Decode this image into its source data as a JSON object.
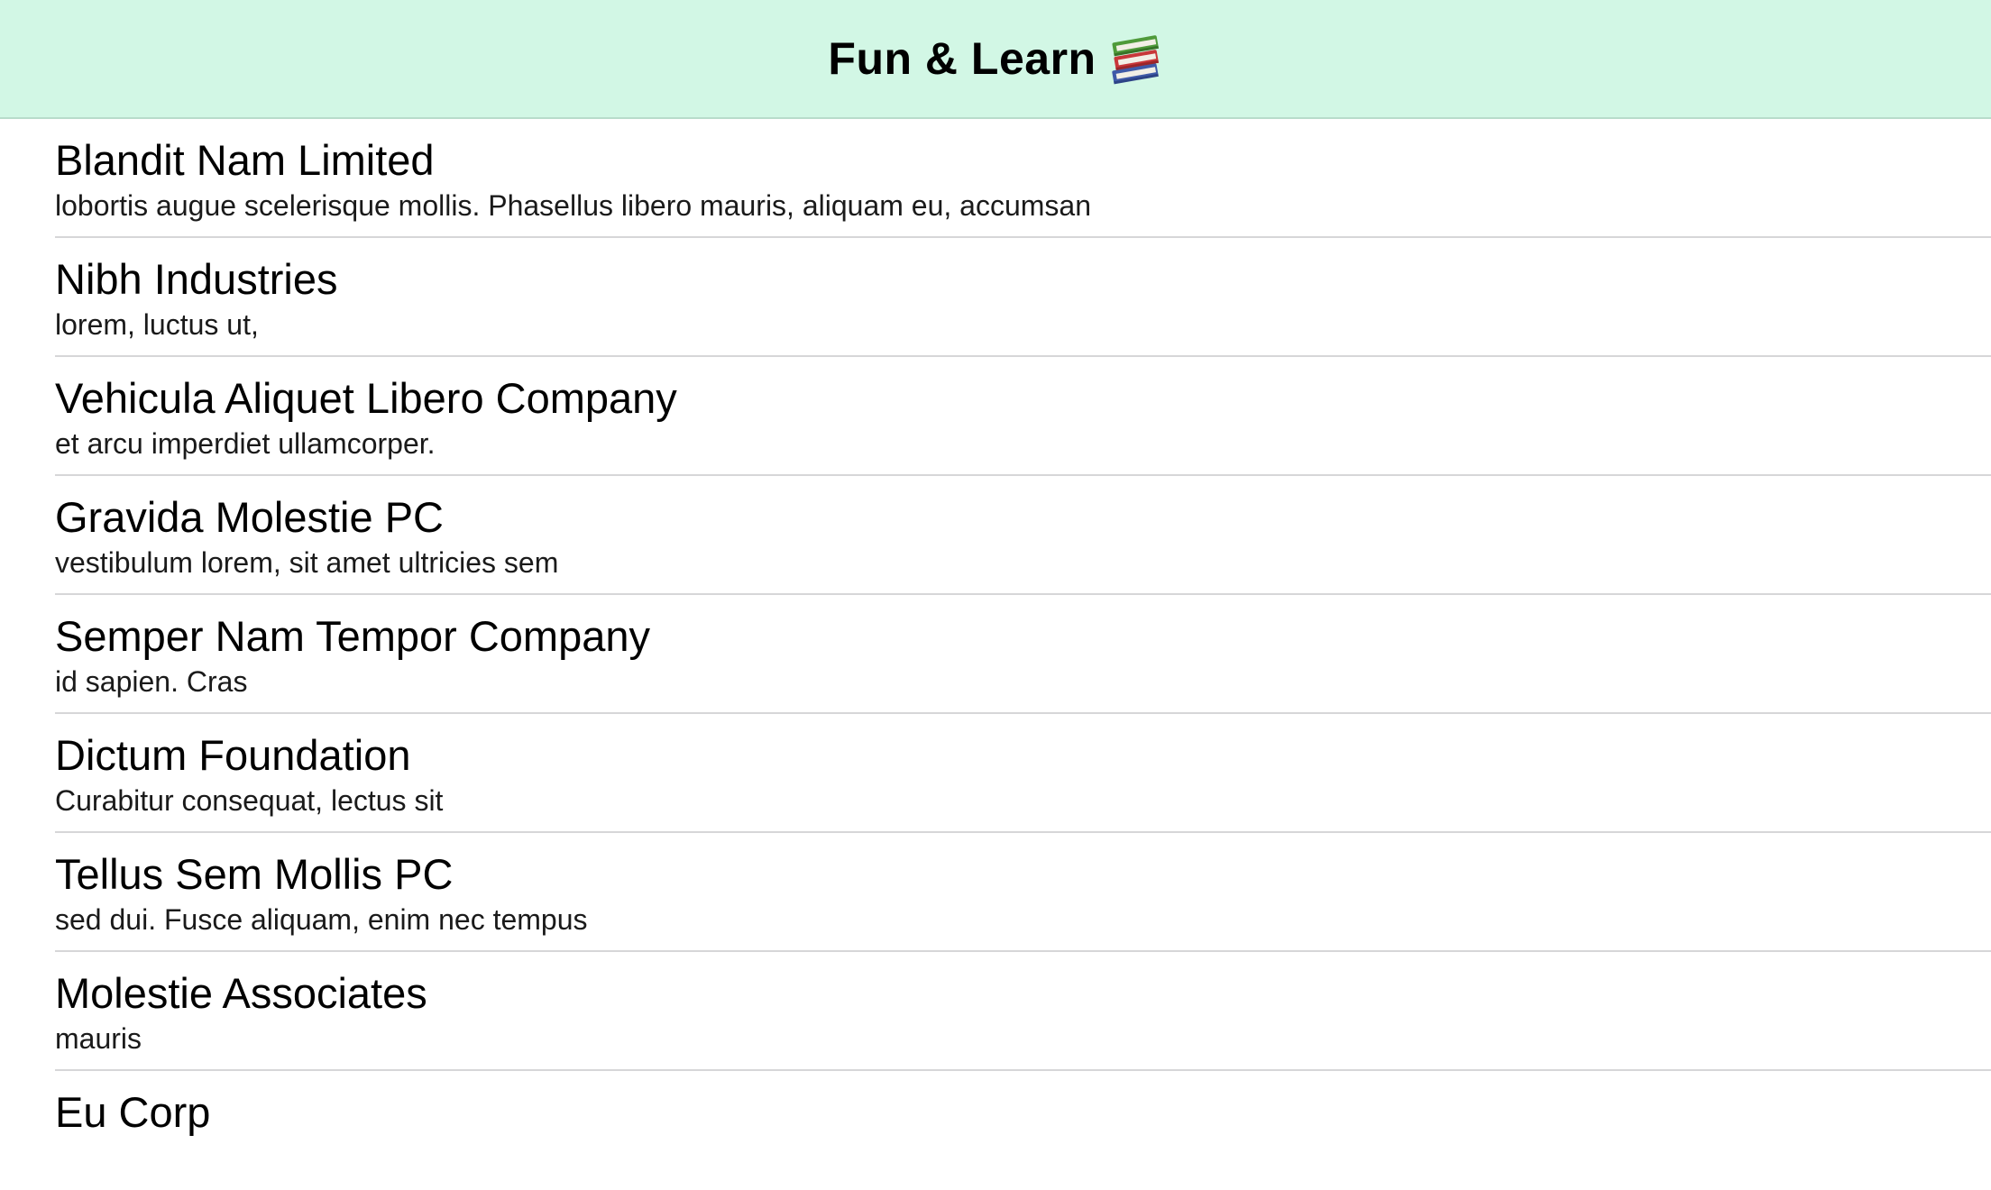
{
  "nav": {
    "title": "Fun & Learn",
    "icon": "books-icon",
    "background": "#d2f7e5"
  },
  "list": {
    "items": [
      {
        "title": "Blandit Nam Limited",
        "subtitle": "lobortis augue scelerisque mollis. Phasellus libero mauris, aliquam eu, accumsan"
      },
      {
        "title": "Nibh Industries",
        "subtitle": "lorem, luctus ut,"
      },
      {
        "title": "Vehicula Aliquet Libero Company",
        "subtitle": "et arcu imperdiet ullamcorper."
      },
      {
        "title": "Gravida Molestie PC",
        "subtitle": "vestibulum lorem, sit amet ultricies sem"
      },
      {
        "title": "Semper Nam Tempor Company",
        "subtitle": "id sapien. Cras"
      },
      {
        "title": "Dictum Foundation",
        "subtitle": "Curabitur consequat, lectus sit"
      },
      {
        "title": "Tellus Sem Mollis PC",
        "subtitle": "sed dui. Fusce aliquam, enim nec tempus"
      },
      {
        "title": "Molestie Associates",
        "subtitle": "mauris"
      },
      {
        "title": "Eu Corp",
        "subtitle": ""
      }
    ]
  }
}
